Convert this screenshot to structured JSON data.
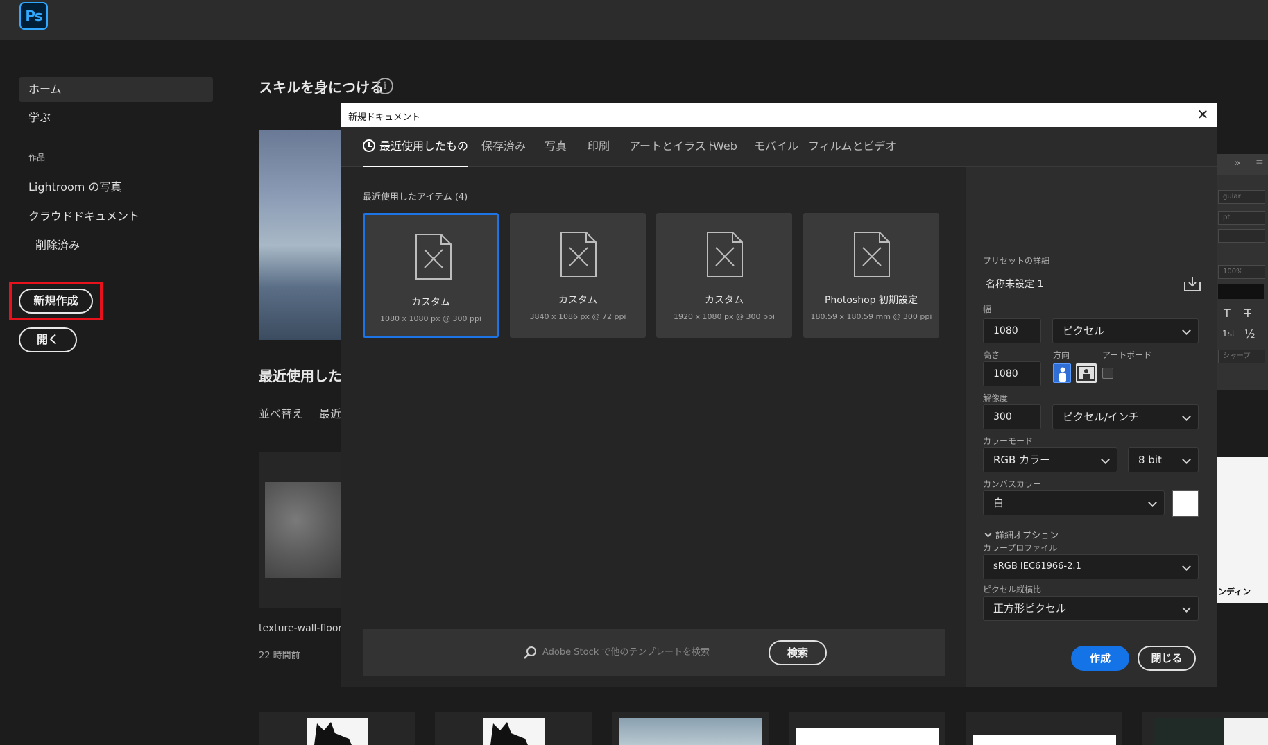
{
  "app": {
    "logo": "Ps"
  },
  "sidebar": {
    "home": "ホーム",
    "learn": "学ぶ",
    "works_label": "作品",
    "lightroom": "Lightroom の写真",
    "cloud_docs": "クラウドドキュメント",
    "deleted": "削除済み",
    "new_button": "新規作成",
    "open_button": "開く"
  },
  "main": {
    "skill_title": "スキルを身につける",
    "info_icon": "i",
    "recent_title": "最近使用した",
    "sort_label": "並べ替え",
    "recent_label": "最近",
    "file_name": "texture-wall-floor-",
    "file_time": "22 時間前"
  },
  "right_panel": {
    "field1": "gular",
    "field2": "pt",
    "field3": "100%",
    "glyph1": "T",
    "glyph2": "1st",
    "glyph3": "½",
    "sharp": "シャープ",
    "white_text": "ンディン"
  },
  "dialog": {
    "title": "新規ドキュメント",
    "close": "✕",
    "tabs": [
      {
        "label": "最近使用したもの"
      },
      {
        "label": "保存済み"
      },
      {
        "label": "写真"
      },
      {
        "label": "印刷"
      },
      {
        "label": "アートとイラスト"
      },
      {
        "label": "Web"
      },
      {
        "label": "モバイル"
      },
      {
        "label": "フィルムとビデオ"
      }
    ],
    "recent_items_label": "最近使用したアイテム (4)",
    "presets": [
      {
        "name": "カスタム",
        "desc": "1080 x 1080 px @ 300 ppi"
      },
      {
        "name": "カスタム",
        "desc": "3840 x 1086 px @ 72 ppi"
      },
      {
        "name": "カスタム",
        "desc": "1920 x 1080 px @ 300 ppi"
      },
      {
        "name": "Photoshop 初期設定",
        "desc": "180.59 x 180.59 mm @ 300 ppi"
      }
    ],
    "search": {
      "placeholder": "Adobe Stock で他のテンプレートを検索",
      "button": "検索"
    },
    "details": {
      "header": "プリセットの詳細",
      "preset_name": "名称未設定 1",
      "width_label": "幅",
      "width_value": "1080",
      "width_unit": "ピクセル",
      "height_label": "高さ",
      "height_value": "1080",
      "orientation_label": "方向",
      "artboard_label": "アートボード",
      "resolution_label": "解像度",
      "resolution_value": "300",
      "resolution_unit": "ピクセル/インチ",
      "color_mode_label": "カラーモード",
      "color_mode": "RGB カラー",
      "bit_depth": "8 bit",
      "canvas_label": "カンバスカラー",
      "canvas_value": "白",
      "advanced": "詳細オプション",
      "profile_label": "カラープロファイル",
      "profile_value": "sRGB IEC61966-2.1",
      "aspect_label": "ピクセル縦横比",
      "aspect_value": "正方形ピクセル",
      "create": "作成",
      "close": "閉じる"
    }
  },
  "colors": {
    "accent": "#1473e6",
    "highlight": "#e8121c",
    "ps_blue": "#31a8ff"
  }
}
